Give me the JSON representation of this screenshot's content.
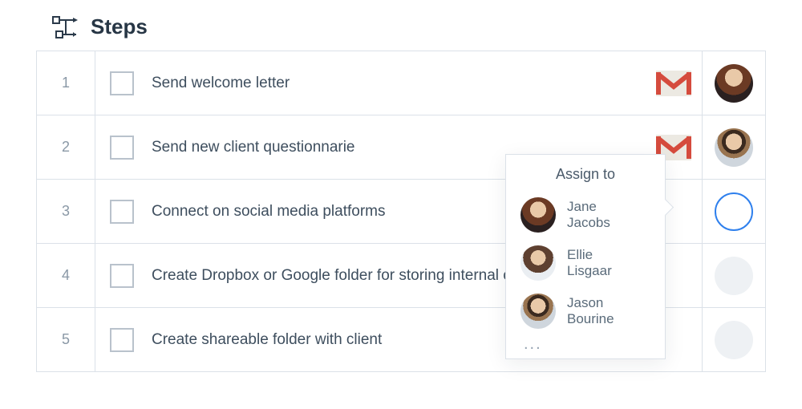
{
  "header": {
    "title": "Steps"
  },
  "steps": [
    {
      "num": "1",
      "text": "Send welcome letter",
      "app": "gmail",
      "assignee": "a",
      "assignee_name": "Jane Jacobs"
    },
    {
      "num": "2",
      "text": "Send new client questionnarie",
      "app": "gmail",
      "assignee": "c",
      "assignee_name": "Jason Bourine"
    },
    {
      "num": "3",
      "text": "Connect on social media platforms",
      "app": null,
      "assignee": "selectable",
      "assignee_name": null
    },
    {
      "num": "4",
      "text": "Create Dropbox or Google folder for storing internal client documents",
      "app": null,
      "assignee": "placeholder",
      "assignee_name": null
    },
    {
      "num": "5",
      "text": "Create shareable folder with client",
      "app": null,
      "assignee": "placeholder",
      "assignee_name": null
    }
  ],
  "assign_popover": {
    "title": "Assign to",
    "people": [
      {
        "name": "Jane Jacobs",
        "avatar": "a"
      },
      {
        "name": "Ellie Lisgaar",
        "avatar": "b"
      },
      {
        "name": "Jason Bourine",
        "avatar": "c"
      }
    ],
    "more": "..."
  }
}
